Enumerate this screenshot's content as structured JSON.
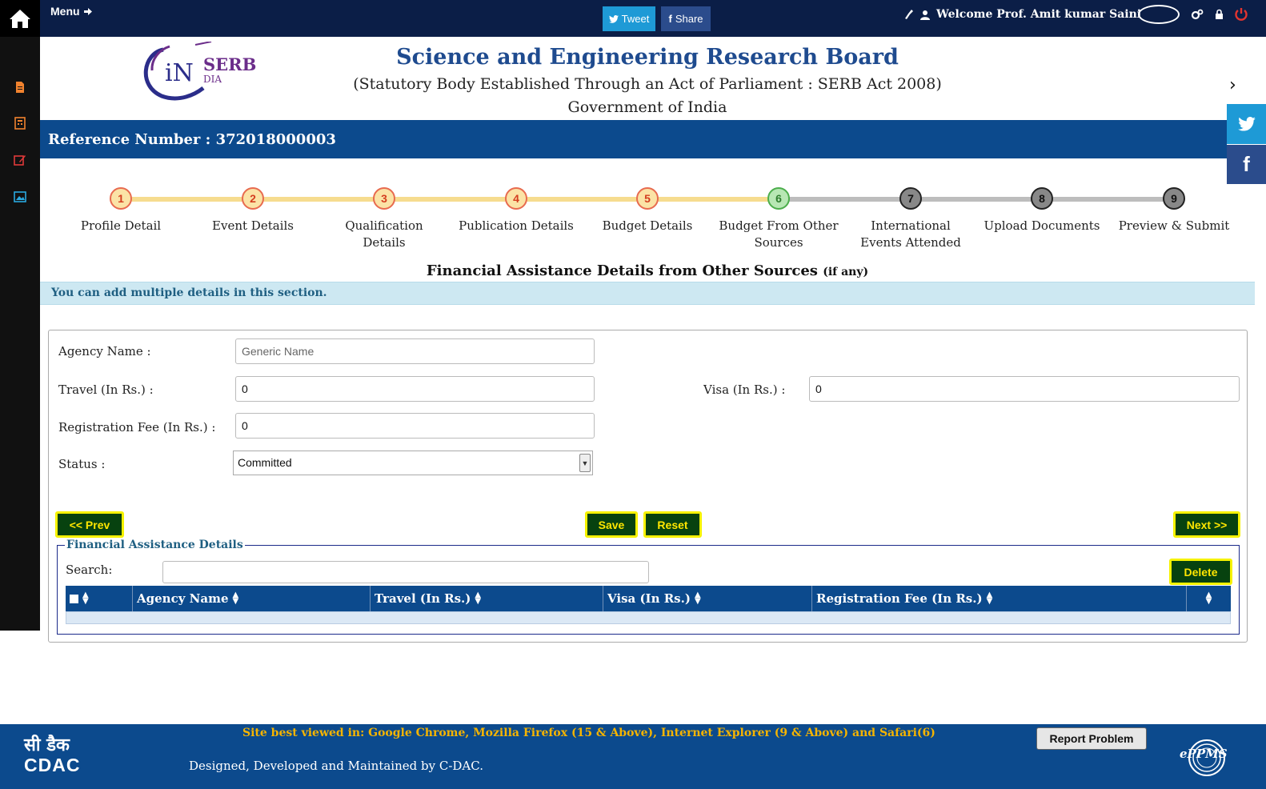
{
  "topbar": {
    "menu_label": "Menu",
    "tweet_label": "Tweet",
    "share_label": "Share",
    "welcome": "Welcome Prof. Amit kumar Saini"
  },
  "header": {
    "logo_text": "SERB",
    "logo_sub": "DIA",
    "logo_letters": "iN",
    "title": "Science and Engineering Research Board",
    "subtitle": "(Statutory Body Established Through an Act of Parliament : SERB Act 2008)",
    "government": "Government of India"
  },
  "reference": "Reference Number : 372018000003",
  "steps": [
    {
      "num": "1",
      "label": "Profile Detail",
      "state": "done"
    },
    {
      "num": "2",
      "label": "Event Details",
      "state": "done"
    },
    {
      "num": "3",
      "label": "Qualification Details",
      "state": "done"
    },
    {
      "num": "4",
      "label": "Publication Details",
      "state": "done"
    },
    {
      "num": "5",
      "label": "Budget Details",
      "state": "done"
    },
    {
      "num": "6",
      "label": "Budget From Other Sources",
      "state": "active"
    },
    {
      "num": "7",
      "label": "International Events Attended",
      "state": "todo"
    },
    {
      "num": "8",
      "label": "Upload Documents",
      "state": "todo"
    },
    {
      "num": "9",
      "label": "Preview & Submit",
      "state": "todo"
    }
  ],
  "section": {
    "title": "Financial Assistance Details from Other Sources",
    "title_small": "(if any)",
    "info": "You can add multiple details in this section."
  },
  "form": {
    "agency_label": "Agency Name :",
    "agency_value": "",
    "agency_placeholder": "Generic Name",
    "travel_label": "Travel (In Rs.) :",
    "travel_value": "0",
    "visa_label": "Visa (In Rs.) :",
    "visa_value": "0",
    "regfee_label": "Registration Fee (In Rs.) :",
    "regfee_value": "0",
    "status_label": "Status :",
    "status_value": "Committed"
  },
  "buttons": {
    "prev": "<< Prev",
    "save": "Save",
    "reset": "Reset",
    "next": "Next >>",
    "delete": "Delete",
    "report": "Report Problem"
  },
  "table": {
    "legend": "Financial Assistance Details",
    "search_label": "Search:",
    "columns": [
      "Agency Name",
      "Travel (In Rs.)",
      "Visa (In Rs.)",
      "Registration Fee (In Rs.)"
    ]
  },
  "footer": {
    "best_viewed": "Site best viewed in: Google Chrome, Mozilla Firefox (15 & Above), Internet Explorer (9 & Above) and Safari(6)",
    "designed": "Designed, Developed and Maintained by C-DAC.",
    "cdac_hindi": "सी डैक",
    "cdac": "CDAC",
    "eppms": "ePPMS"
  },
  "colors": {
    "navy": "#0b1e47",
    "brand_blue": "#0c4a8d",
    "title_blue": "#1f4b8f",
    "button_green": "#07420f",
    "button_text": "#ffe600",
    "footer_note": "#f5b400"
  }
}
